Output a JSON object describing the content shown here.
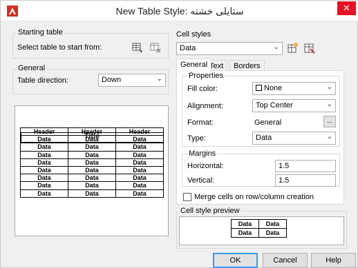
{
  "window": {
    "title": "New Table Style: ستایلی خشته",
    "close_glyph": "✕"
  },
  "starting_table": {
    "group_title": "Starting table",
    "prompt": "Select table to start from:"
  },
  "general_left": {
    "group_title": "General",
    "direction_label": "Table direction:",
    "direction_value": "Down"
  },
  "table_preview": {
    "title": "Title",
    "headers": [
      "Header",
      "Header",
      "Header"
    ],
    "rows": [
      [
        "Data",
        "Data",
        "Data"
      ],
      [
        "Data",
        "Data",
        "Data"
      ],
      [
        "Data",
        "Data",
        "Data"
      ],
      [
        "Data",
        "Data",
        "Data"
      ],
      [
        "Data",
        "Data",
        "Data"
      ],
      [
        "Data",
        "Data",
        "Data"
      ],
      [
        "Data",
        "Data",
        "Data"
      ],
      [
        "Data",
        "Data",
        "Data"
      ]
    ]
  },
  "cell_styles": {
    "group_title": "Cell styles",
    "selected": "Data"
  },
  "tabs": [
    "General",
    "Text",
    "Borders"
  ],
  "properties": {
    "group_title": "Properties",
    "fill_color_label": "Fill color:",
    "fill_color_value": "None",
    "alignment_label": "Alignment:",
    "alignment_value": "Top Center",
    "format_label": "Format:",
    "format_value": "General",
    "format_button": "...",
    "type_label": "Type:",
    "type_value": "Data"
  },
  "margins": {
    "group_title": "Margins",
    "horizontal_label": "Horizontal:",
    "horizontal_value": "1.5",
    "vertical_label": "Vertical:",
    "vertical_value": "1.5"
  },
  "merge_label": "Merge cells on row/column creation",
  "cell_preview": {
    "group_title": "Cell style preview",
    "rows": [
      [
        "Data",
        "Data"
      ],
      [
        "Data",
        "Data"
      ]
    ]
  },
  "buttons": {
    "ok": "OK",
    "cancel": "Cancel",
    "help": "Help"
  },
  "colors": {
    "close_red": "#e81123",
    "accent_blue": "#3399ff",
    "icon_red": "#d0301e"
  }
}
